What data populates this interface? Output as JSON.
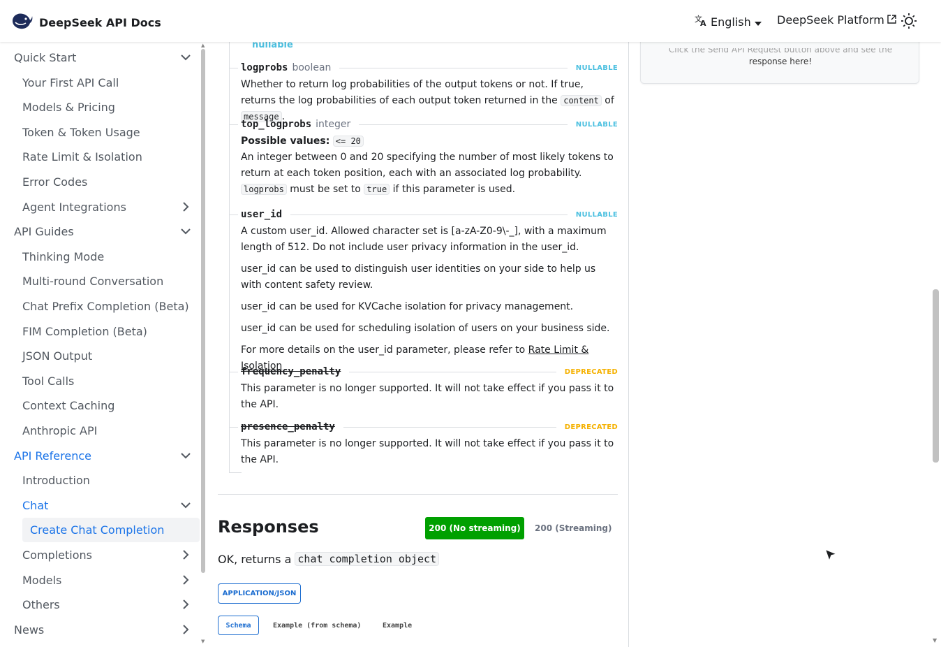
{
  "navbar": {
    "title": "DeepSeek API Docs",
    "language": "English",
    "platform": "DeepSeek Platform"
  },
  "sidebar": {
    "items": [
      {
        "label": "Quick Start",
        "chevron": "down",
        "level": 0
      },
      {
        "label": "Your First API Call",
        "level": 1
      },
      {
        "label": "Models & Pricing",
        "level": 1
      },
      {
        "label": "Token & Token Usage",
        "level": 1
      },
      {
        "label": "Rate Limit & Isolation",
        "level": 1
      },
      {
        "label": "Error Codes",
        "level": 1
      },
      {
        "label": "Agent Integrations",
        "chevron": "right",
        "level": 1
      },
      {
        "label": "API Guides",
        "chevron": "down",
        "level": 0
      },
      {
        "label": "Thinking Mode",
        "level": 1
      },
      {
        "label": "Multi-round Conversation",
        "level": 1
      },
      {
        "label": "Chat Prefix Completion (Beta)",
        "level": 1
      },
      {
        "label": "FIM Completion (Beta)",
        "level": 1
      },
      {
        "label": "JSON Output",
        "level": 1
      },
      {
        "label": "Tool Calls",
        "level": 1
      },
      {
        "label": "Context Caching",
        "level": 1
      },
      {
        "label": "Anthropic API",
        "level": 1
      },
      {
        "label": "API Reference",
        "chevron": "down",
        "level": 0,
        "active": true
      },
      {
        "label": "Introduction",
        "level": 1
      },
      {
        "label": "Chat",
        "chevron": "down",
        "level": 1,
        "active": true
      },
      {
        "label": "Create Chat Completion",
        "level": 2,
        "selected": true
      },
      {
        "label": "Completions",
        "chevron": "right",
        "level": 1
      },
      {
        "label": "Models",
        "chevron": "right",
        "level": 1
      },
      {
        "label": "Others",
        "chevron": "right",
        "level": 1
      },
      {
        "label": "News",
        "chevron": "right",
        "level": 0
      }
    ]
  },
  "main": {
    "nullable_top": "nullable",
    "logprobs": {
      "name": "logprobs",
      "type": "boolean",
      "badge": "NULLABLE",
      "desc_1": "Whether to return log probabilities of the output tokens or not. If true, returns the log probabilities of each output token returned in the",
      "code_1": "content",
      "desc_2": "of",
      "code_2": "message",
      "desc_3": "."
    },
    "top_logprobs": {
      "name": "top_logprobs",
      "type": "integer",
      "badge": "NULLABLE",
      "possible_label": "Possible values:",
      "possible_code": "<= 20",
      "desc_1": "An integer between 0 and 20 specifying the number of most likely tokens to return at each token position, each with an associated log probability.",
      "code_1": "logprobs",
      "desc_2": "must be set to",
      "code_2": "true",
      "desc_3": "if this parameter is used."
    },
    "user_id": {
      "name": "user_id",
      "badge": "NULLABLE",
      "p1": "A custom user_id. Allowed character set is [a-zA-Z0-9\\-_], with a maximum length of 512. Do not include user privacy information in the user_id.",
      "p2": "user_id can be used to distinguish user identities on your side to help us with content safety review.",
      "p3": "user_id can be used for KVCache isolation for privacy management.",
      "p4": "user_id can be used for scheduling isolation of users on your business side.",
      "p5": "For more details on the user_id parameter, please refer to",
      "p5_link": "Rate Limit & Isolation"
    },
    "frequency_penalty": {
      "name": "frequency_penalty",
      "badge": "DEPRECATED",
      "desc": "This parameter is no longer supported. It will not take effect if you pass it to the API."
    },
    "presence_penalty": {
      "name": "presence_penalty",
      "badge": "DEPRECATED",
      "desc": "This parameter is no longer supported. It will not take effect if you pass it to the API."
    },
    "responses": {
      "title": "Responses",
      "tab_active": "200 (No streaming)",
      "tab_other": "200 (Streaming)",
      "ok_text": "OK, returns a",
      "ok_code": "chat completion object",
      "mime": "APPLICATION/JSON",
      "schema_tabs": [
        "Schema",
        "Example (from schema)",
        "Example"
      ]
    }
  },
  "right_panel": {
    "text_top": "Click the Send API Request button above and see the",
    "text_bottom": "response here!"
  },
  "colors": {
    "accent": "#1a73e8",
    "link": "#1c6dd0",
    "nullable": "#4dc0e0",
    "deprecated": "#f5b100",
    "success": "#00a000"
  }
}
